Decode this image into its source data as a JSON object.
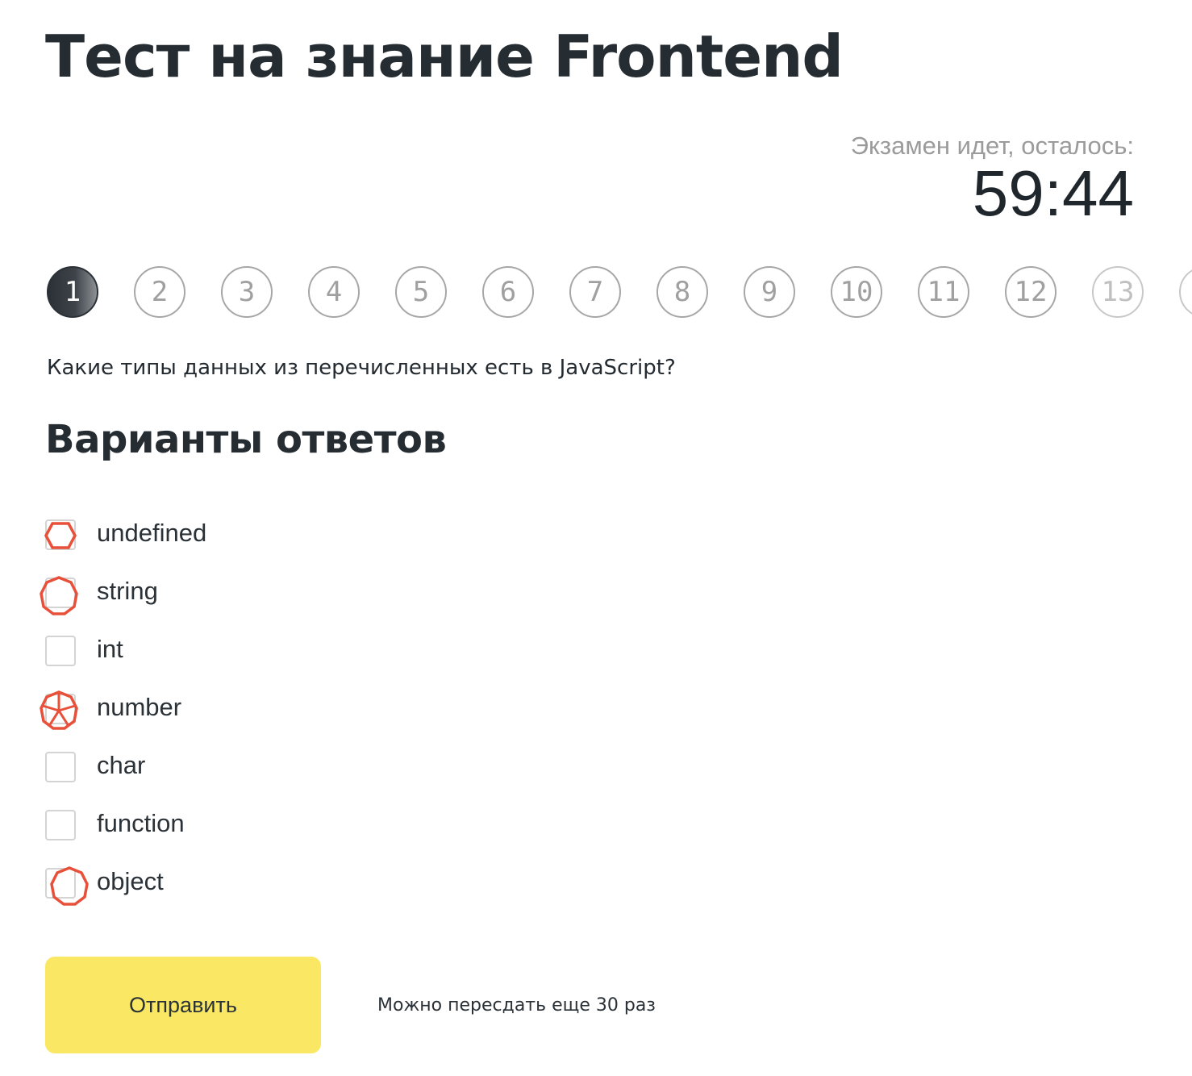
{
  "header": {
    "title": "Тест на знание Frontend"
  },
  "timer": {
    "caption": "Экзамен идет, осталось:",
    "value": "59:44"
  },
  "question_nav": {
    "active": 1,
    "visible_numbers": [
      "1",
      "2",
      "3",
      "4",
      "5",
      "6",
      "7",
      "8",
      "9",
      "10",
      "11",
      "12",
      "13"
    ]
  },
  "question": {
    "text": "Какие типы данных из перечисленных есть в JavaScript?"
  },
  "answers": {
    "heading": "Варианты ответов",
    "options": [
      {
        "label": "undefined",
        "mark": "hexagon-icon"
      },
      {
        "label": "string",
        "mark": "octagon-icon"
      },
      {
        "label": "int",
        "mark": "none"
      },
      {
        "label": "number",
        "mark": "asterisk-octagon-icon"
      },
      {
        "label": "char",
        "mark": "none"
      },
      {
        "label": "function",
        "mark": "none"
      },
      {
        "label": "object",
        "mark": "octagon-icon"
      }
    ],
    "mark_color": "#e8503a"
  },
  "footer": {
    "submit_label": "Отправить",
    "retakes_note": "Можно пересдать еще 30 раз"
  },
  "colors": {
    "accent_button": "#fae864",
    "text_dark": "#252c32",
    "muted": "#9b9b9b"
  }
}
